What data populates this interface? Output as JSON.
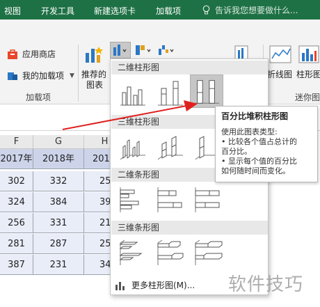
{
  "tabs": [
    "视图",
    "开发工具",
    "新建选项卡",
    "加载项"
  ],
  "tell_me": "告诉我您想要做什么...",
  "ribbon": {
    "app_store": "应用商店",
    "my_addins": "我的加载项",
    "addins_group": "加载项",
    "recommended_line1": "推荐的",
    "recommended_line2": "图表",
    "line_chart": "折线图",
    "column_chart": "柱形图",
    "sparklines_group": "迷你图"
  },
  "columns": [
    "F",
    "G",
    "H"
  ],
  "table": {
    "header": [
      "2017年",
      "2018年",
      "201"
    ],
    "rows": [
      [
        "302",
        "332",
        "25"
      ],
      [
        "324",
        "384",
        "39"
      ],
      [
        "256",
        "331",
        "21"
      ],
      [
        "281",
        "287",
        "25"
      ],
      [
        "387",
        "231",
        "34"
      ]
    ]
  },
  "menu": {
    "sections": [
      "二维柱形图",
      "三维柱形图",
      "二维条形图",
      "三维条形图"
    ],
    "more": "更多柱形图(M)..."
  },
  "tooltip": {
    "title": "百分比堆积柱形图",
    "lines": [
      "使用此图表类型:",
      "• 比较各个值占总计的",
      "百分比。",
      "• 显示每个值的百分比",
      "如何随时间而变化。"
    ]
  },
  "watermark": "软件技巧",
  "colors": {
    "ribbon_green": "#1e7145",
    "header_fill": "#cdd4ea",
    "cell_fill": "#e9edf8",
    "arrow": "#e02020"
  }
}
